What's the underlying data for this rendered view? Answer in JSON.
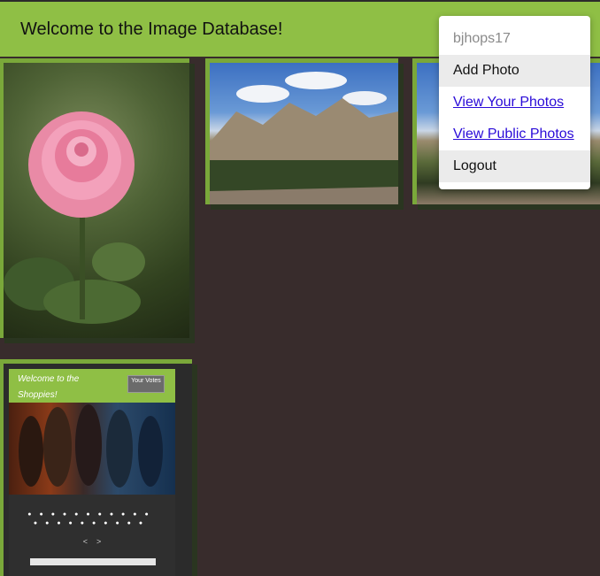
{
  "header": {
    "title": "Welcome to the Image Database!"
  },
  "menu": {
    "username": "bjhops17",
    "add_photo": "Add Photo",
    "view_your_photos": "View Your Photos",
    "view_public_photos": "View Public Photos",
    "logout": "Logout"
  },
  "gallery": {
    "tiles": [
      {
        "icon": "rose-photo"
      },
      {
        "icon": "mountain-photo"
      },
      {
        "icon": "mountain-photo"
      },
      {
        "icon": "shoppies-screenshot"
      }
    ],
    "shoppies": {
      "heading": "Welcome to the Shoppies!",
      "votes_button": "Your Votes",
      "nav_prev": "<",
      "nav_next": ">"
    }
  },
  "colors": {
    "header": "#8fbf45",
    "background": "#382c2c",
    "link": "#2a0bd8"
  }
}
